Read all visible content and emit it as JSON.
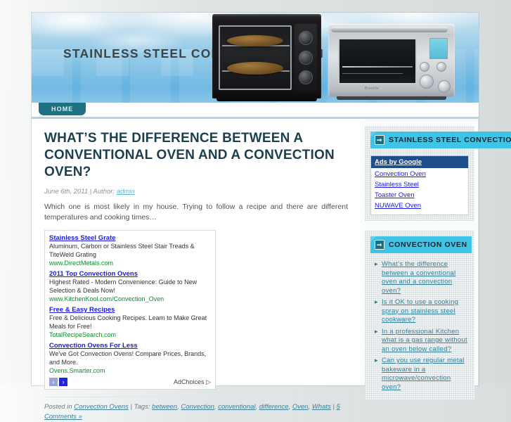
{
  "banner": {
    "title": "STAINLESS STEEL CONVECTION OVEN",
    "oven_black_alt": "black-convection-oven-photo",
    "oven_steel_alt": "stainless-steel-toaster-oven-photo",
    "steel_brand": "Breville"
  },
  "nav": {
    "items": [
      {
        "label": "HOME"
      }
    ]
  },
  "post": {
    "title": "WHAT’S THE DIFFERENCE BETWEEN A CONVENTIONAL OVEN AND A CONVECTION OVEN?",
    "date": "June 6th, 2011",
    "author_prefix": "| Author:",
    "author": "admin",
    "excerpt": "Which one is most likely in my house. Trying to follow a recipe and there are different temperatures and cooking times…",
    "footer": {
      "posted_in_label": "Posted in",
      "category": "Convection Ovens",
      "sep1": "|",
      "tags_label": "Tags:",
      "tags": [
        "between",
        "Convection",
        "conventional",
        "difference",
        "Oven",
        "Whats"
      ],
      "sep2": "|",
      "comments": "5 Comments »"
    }
  },
  "content_ads": {
    "items": [
      {
        "title": "Stainless Steel Grate",
        "desc": "Aluminum, Carbon or Stainless Steel Stair Treads & TiteWeld Grating",
        "url": "www.DirectMetals.com"
      },
      {
        "title": "2011 Top Convection Ovens",
        "desc": "Highest Rated - Modern Convenience: Guide to New Selection & Deals Now!",
        "url": "www.KitchenKool.com/Convection_Oven"
      },
      {
        "title": "Free & Easy Recipes",
        "desc": "Free & Delicious Cooking Recipes. Learn to Make Great Meals for Free!",
        "url": "TotalRecipeSearch.com"
      },
      {
        "title": "Convection Ovens For Less",
        "desc": "We've Got Convection Ovens! Compare Prices, Brands, and More.",
        "url": "Ovens.Smarter.com"
      }
    ],
    "prev_label": "‹",
    "next_label": "›",
    "adchoices_label": "AdChoices",
    "adchoices_icon": "▷"
  },
  "sidebar": {
    "widgets": [
      {
        "title": "STAINLESS STEEL CONVECTION OVEN",
        "icon": "arrow-right-icon",
        "type": "google-ads",
        "ads_heading": "Ads by Google",
        "ads_links": [
          "Convection Oven",
          "Stainless Steel",
          "Toaster Oven",
          "NUWAVE Oven"
        ]
      },
      {
        "title": "CONVECTION OVEN",
        "icon": "arrow-right-icon",
        "type": "post-list",
        "posts": [
          "What’s the difference between a conventional oven and a convection oven?",
          "Is it OK to use a cooking spray on stainless steel cookware?",
          "In a professional Kitchen what is a gas range without an oven below called?",
          "Can you use regular metal bakeware in a microwave/convection oven?"
        ]
      }
    ]
  },
  "colors": {
    "accent_cyan": "#3ec4e6",
    "tab_teal": "#1e7183",
    "heading_navy": "#1d3f4d",
    "ad_title_blue": "#1a1ae0",
    "ad_url_green": "#0a8f2a",
    "gads_header_blue": "#1f4e8c",
    "link_teal": "#2f7f9c"
  }
}
